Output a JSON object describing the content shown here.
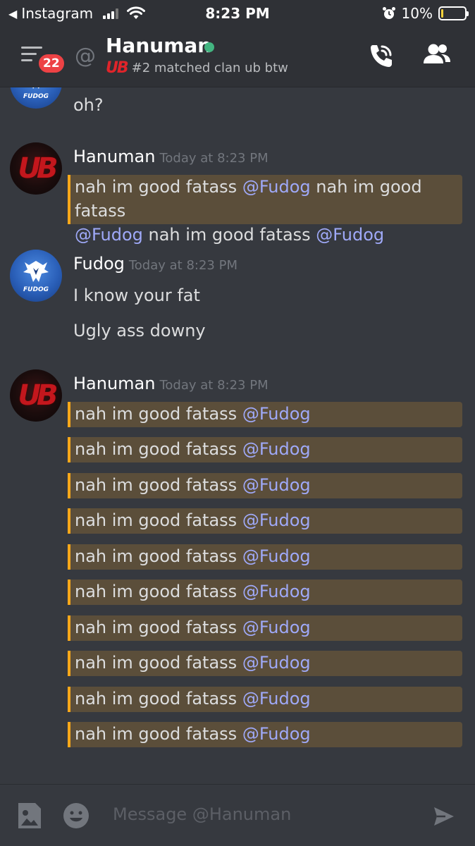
{
  "status_bar": {
    "back_label": "Instagram",
    "time": "8:23 PM",
    "battery": "10%",
    "battery_level": 0.1
  },
  "header": {
    "badge_count": "22",
    "dm_name": "Hanuman",
    "status_text": "#2 matched clan ub btw",
    "status_logo_text": "UB"
  },
  "messages": {
    "partial": {
      "text": "oh?"
    },
    "group1": {
      "author": "Hanuman",
      "timestamp": "Today at 8:23 PM",
      "line1_a": "nah im good fatass ",
      "line1_mention": "@Fudog",
      "line1_b": " nah im good fatass",
      "line2_mention": "@Fudog",
      "line2_b": " nah im good fatass ",
      "line2_mention2": "@Fudog"
    },
    "group2": {
      "author": "Fudog",
      "timestamp": "Today at 8:23 PM",
      "avatar_text": "FUDOG",
      "line1": "I know your fat",
      "line2": "Ugly ass downy"
    },
    "group3": {
      "author": "Hanuman",
      "timestamp": "Today at 8:23 PM",
      "avatar_text": "UB",
      "repeated": [
        {
          "text": "nah im good fatass ",
          "mention": "@Fudog"
        },
        {
          "text": "nah im good fatass ",
          "mention": "@Fudog"
        },
        {
          "text": "nah im good fatass ",
          "mention": "@Fudog"
        },
        {
          "text": "nah im good fatass ",
          "mention": "@Fudog"
        },
        {
          "text": "nah im good fatass ",
          "mention": "@Fudog"
        },
        {
          "text": "nah im good fatass ",
          "mention": "@Fudog"
        },
        {
          "text": "nah im good fatass ",
          "mention": "@Fudog"
        },
        {
          "text": "nah im good fatass ",
          "mention": "@Fudog"
        },
        {
          "text": "nah im good fatass ",
          "mention": "@Fudog"
        },
        {
          "text": "nah im good fatass ",
          "mention": "@Fudog"
        }
      ]
    }
  },
  "composer": {
    "placeholder": "Message @Hanuman"
  },
  "colors": {
    "background": "#36393f",
    "header": "#2f3136",
    "highlight": "#5b4e3a",
    "highlight_border": "#faa81a",
    "mention": "#9fa9f8",
    "online": "#43b581",
    "badge": "#ed4245"
  }
}
